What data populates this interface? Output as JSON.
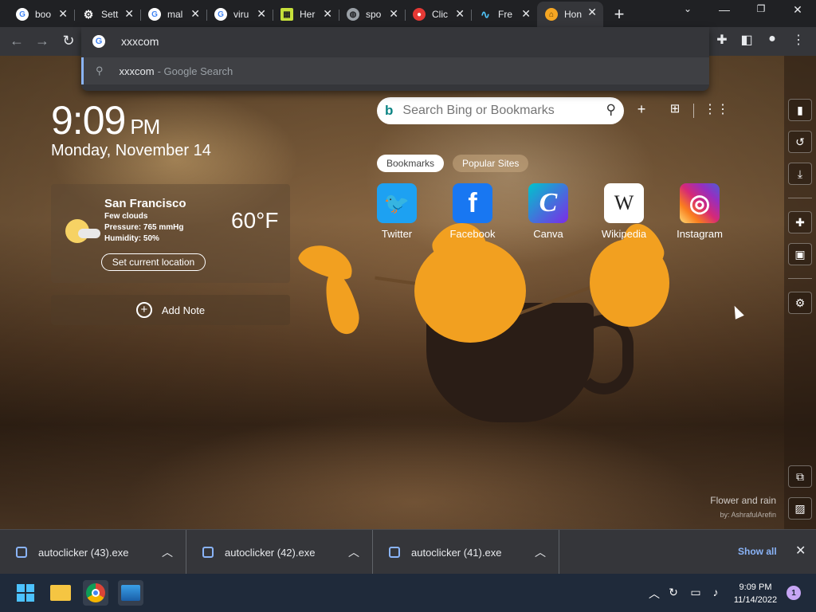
{
  "tabs": [
    {
      "title": "boo",
      "icon": "google-icon"
    },
    {
      "title": "Sett",
      "icon": "gear-icon"
    },
    {
      "title": "mal",
      "icon": "google-icon"
    },
    {
      "title": "viru",
      "icon": "google-icon"
    },
    {
      "title": "Her",
      "icon": "herald-icon"
    },
    {
      "title": "spo",
      "icon": "globe-icon"
    },
    {
      "title": "Clic",
      "icon": "record-icon"
    },
    {
      "title": "Fre",
      "icon": "wave-icon"
    },
    {
      "title": "Hon",
      "icon": "home-icon"
    }
  ],
  "omnibox": {
    "value": "xxxcom",
    "suggestion_query": "xxxcom",
    "suggestion_desc": "- Google Search"
  },
  "newtab": {
    "time": "9:09",
    "ampm": "PM",
    "date": "Monday, November 14",
    "weather": {
      "city": "San Francisco",
      "desc": "Few clouds",
      "pressure": "Pressure: 765 mmHg",
      "humidity": "Humidity: 50%",
      "temp": "60°F",
      "location_button": "Set current location"
    },
    "add_note": "Add Note",
    "search_placeholder": "Search Bing or Bookmarks",
    "pills": [
      "Bookmarks",
      "Popular Sites"
    ],
    "sites": [
      {
        "label": "Twitter",
        "color": "#1da1f2",
        "glyph": "🐦"
      },
      {
        "label": "Facebook",
        "color": "#1877f2",
        "glyph": "f"
      },
      {
        "label": "Canva",
        "color": "#7d2ae8",
        "glyph": "C"
      },
      {
        "label": "Wikipedia",
        "color": "#ffffff",
        "glyph": "W"
      },
      {
        "label": "Instagram",
        "color": "#d62976",
        "glyph": "◎"
      }
    ],
    "credit_title": "Flower and rain",
    "credit_author": "by: AshrafulArefin"
  },
  "downloads": [
    {
      "name": "autoclicker (43).exe"
    },
    {
      "name": "autoclicker (42).exe"
    },
    {
      "name": "autoclicker (41).exe"
    }
  ],
  "show_all": "Show all",
  "taskbar": {
    "time": "9:09 PM",
    "date": "11/14/2022",
    "notifications": "1"
  }
}
